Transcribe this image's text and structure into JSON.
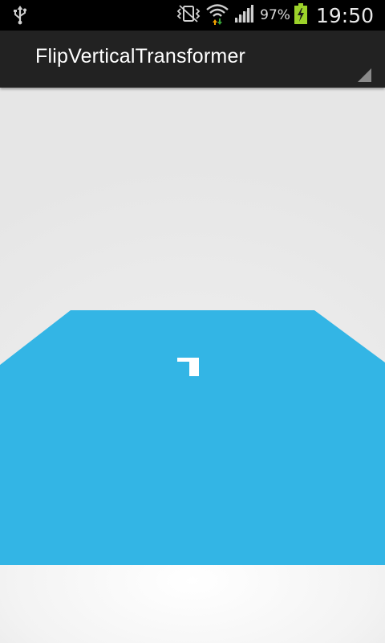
{
  "status_bar": {
    "battery_percent": "97%",
    "time": "19:50",
    "icons": [
      "usb-icon",
      "vibrate-mode-icon",
      "wifi-icon",
      "signal-icon",
      "battery-charging-icon"
    ]
  },
  "action_bar": {
    "title": "FlipVerticalTransformer",
    "overflow_icon": "dropdown-corner-indicator"
  },
  "content": {
    "page_color": "#33b5e5",
    "page_glyph": "7",
    "background_color": "#e8e8e8"
  }
}
